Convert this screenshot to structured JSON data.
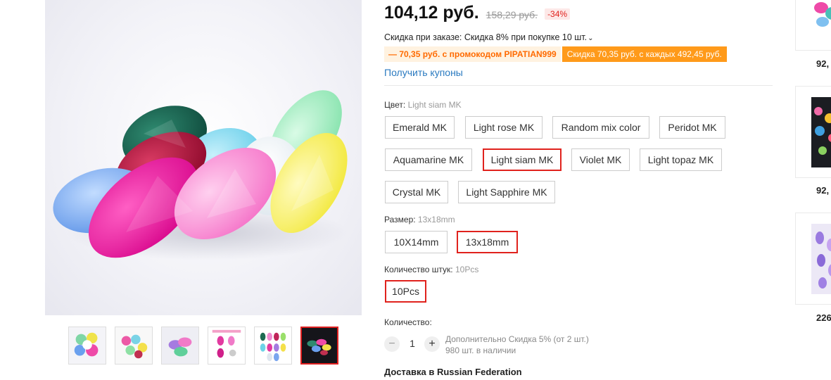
{
  "product": {
    "price": "104,12 руб.",
    "old_price": "158,29 руб.",
    "discount": "-34%",
    "bulk_discount": "Скидка при заказе: Скидка 8% при покупке 10 шт.",
    "promo_code": "— 70,35 руб. с промокодом PIPATIAN999",
    "promo_coupon": "Скидка 70,35 руб. с каждых 492,45 руб.",
    "get_coupons": "Получить купоны"
  },
  "color": {
    "label": "Цвет:",
    "selected": "Light siam MK",
    "options": [
      "Emerald MK",
      "Light rose MK",
      "Random mix color",
      "Peridot MK",
      "Aquamarine MK",
      "Light siam MK",
      "Violet MK",
      "Light topaz MK",
      "Crystal MK",
      "Light Sapphire MK"
    ]
  },
  "size": {
    "label": "Размер:",
    "selected": "13x18mm",
    "options": [
      "10X14mm",
      "13x18mm"
    ]
  },
  "pack": {
    "label": "Количество штук:",
    "selected": "10Pcs",
    "options": [
      "10Pcs"
    ]
  },
  "quantity": {
    "label": "Количество:",
    "minus": "−",
    "value": "1",
    "plus": "+",
    "extra_discount": "Дополнительно Скидка 5% (от 2 шт.)",
    "stock": "980 шт. в наличии"
  },
  "delivery": "Доставка в Russian Federation",
  "recommendations": [
    {
      "price": "92,"
    },
    {
      "price": "92,"
    },
    {
      "price": "226"
    }
  ],
  "colors": {
    "accent_red": "#e0221d",
    "link_blue": "#2a7ac0",
    "promo_orange": "#ff9a1a"
  }
}
